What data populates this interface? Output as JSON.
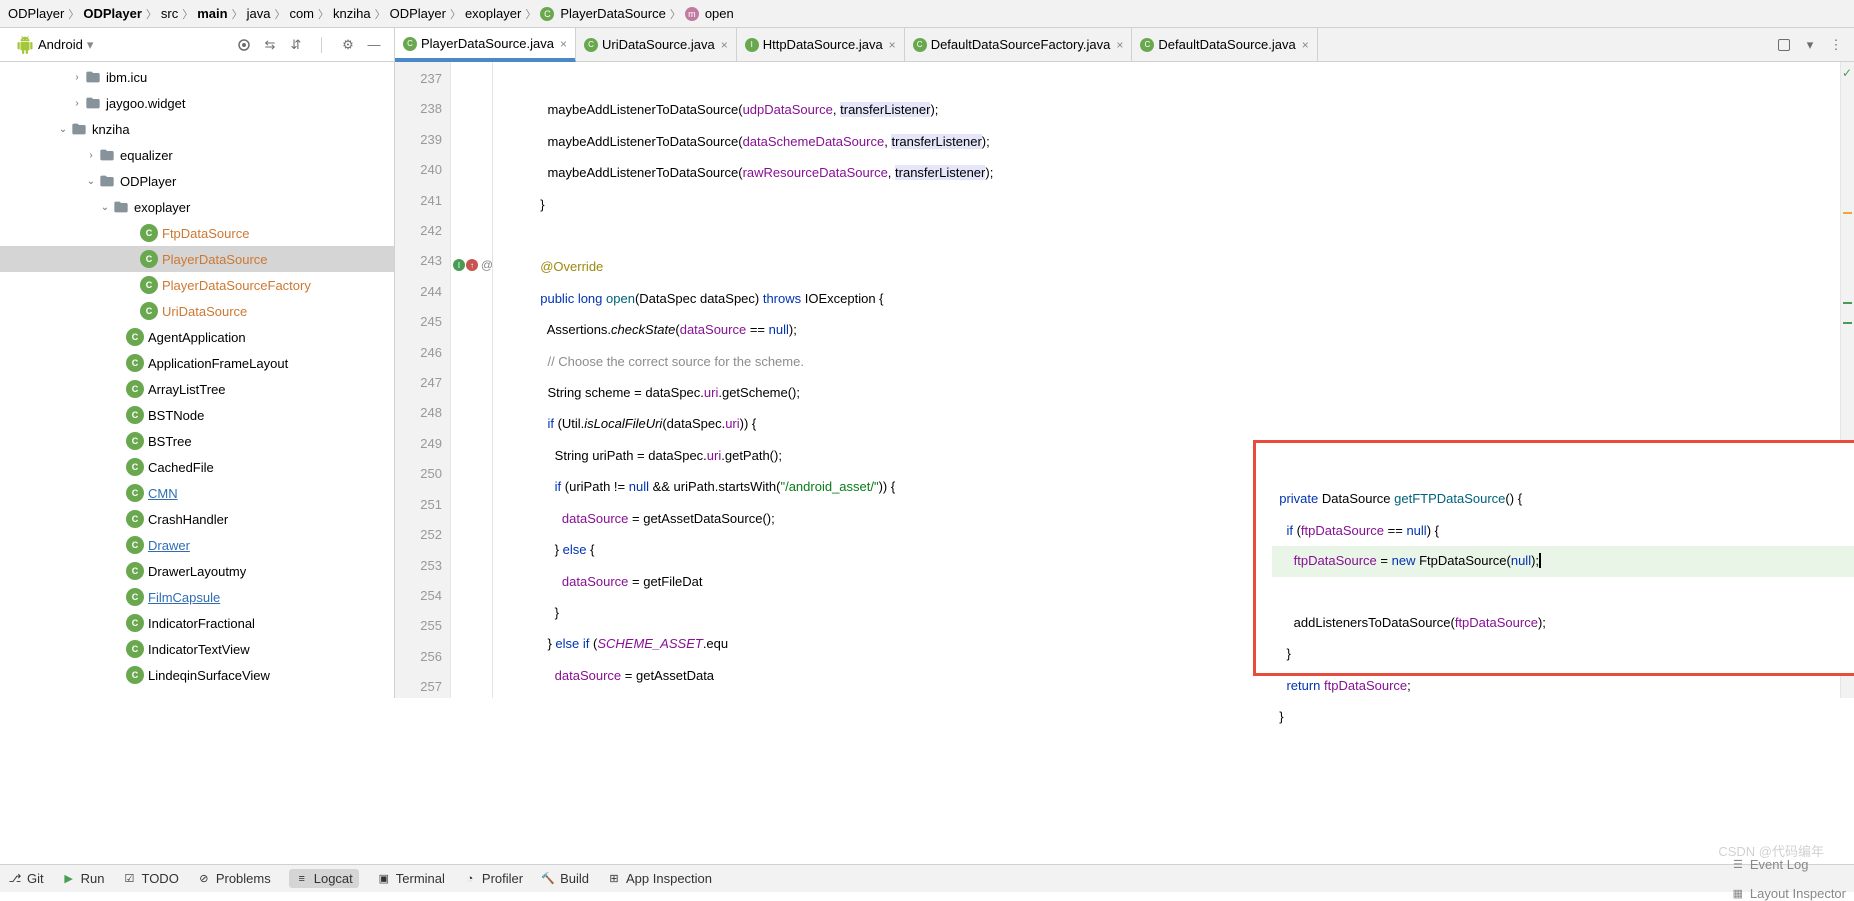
{
  "breadcrumb": {
    "items": [
      "ODPlayer",
      "ODPlayer",
      "src",
      "main",
      "java",
      "com",
      "knziha",
      "ODPlayer",
      "exoplayer",
      "PlayerDataSource",
      "open"
    ],
    "bold": [
      1,
      3
    ]
  },
  "sidebar": {
    "combo": "Android",
    "tree": [
      {
        "indent": 5,
        "tw": ">",
        "icon": "folder",
        "label": "ibm.icu"
      },
      {
        "indent": 5,
        "tw": ">",
        "icon": "folder",
        "label": "jaygoo.widget"
      },
      {
        "indent": 4,
        "tw": "v",
        "icon": "folder",
        "label": "knziha"
      },
      {
        "indent": 6,
        "tw": ">",
        "icon": "folder",
        "label": "equalizer"
      },
      {
        "indent": 6,
        "tw": "v",
        "icon": "folder",
        "label": "ODPlayer"
      },
      {
        "indent": 7,
        "tw": "v",
        "icon": "folder",
        "label": "exoplayer"
      },
      {
        "indent": 9,
        "tw": "",
        "icon": "class",
        "label": "FtpDataSource",
        "cls": "orange"
      },
      {
        "indent": 9,
        "tw": "",
        "icon": "class",
        "label": "PlayerDataSource",
        "cls": "orange",
        "sel": true
      },
      {
        "indent": 9,
        "tw": "",
        "icon": "class",
        "label": "PlayerDataSourceFactory",
        "cls": "orange"
      },
      {
        "indent": 9,
        "tw": "",
        "icon": "class",
        "label": "UriDataSource",
        "cls": "orange"
      },
      {
        "indent": 8,
        "tw": "",
        "icon": "class",
        "label": "AgentApplication"
      },
      {
        "indent": 8,
        "tw": "",
        "icon": "class",
        "label": "ApplicationFrameLayout"
      },
      {
        "indent": 8,
        "tw": "",
        "icon": "class",
        "label": "ArrayListTree"
      },
      {
        "indent": 8,
        "tw": "",
        "icon": "class",
        "label": "BSTNode"
      },
      {
        "indent": 8,
        "tw": "",
        "icon": "class",
        "label": "BSTree"
      },
      {
        "indent": 8,
        "tw": "",
        "icon": "class",
        "label": "CachedFile"
      },
      {
        "indent": 8,
        "tw": "",
        "icon": "class",
        "label": "CMN",
        "cls": "blue"
      },
      {
        "indent": 8,
        "tw": "",
        "icon": "class",
        "label": "CrashHandler"
      },
      {
        "indent": 8,
        "tw": "",
        "icon": "class",
        "label": "Drawer",
        "cls": "blue"
      },
      {
        "indent": 8,
        "tw": "",
        "icon": "class",
        "label": "DrawerLayoutmy"
      },
      {
        "indent": 8,
        "tw": "",
        "icon": "class",
        "label": "FilmCapsule",
        "cls": "blue"
      },
      {
        "indent": 8,
        "tw": "",
        "icon": "class",
        "label": "IndicatorFractional"
      },
      {
        "indent": 8,
        "tw": "",
        "icon": "class",
        "label": "IndicatorTextView"
      },
      {
        "indent": 8,
        "tw": "",
        "icon": "class",
        "label": "LindeqinSurfaceView"
      }
    ]
  },
  "tabs": [
    {
      "ico": "c",
      "label": "PlayerDataSource.java",
      "active": true
    },
    {
      "ico": "c",
      "label": "UriDataSource.java"
    },
    {
      "ico": "i",
      "label": "HttpDataSource.java"
    },
    {
      "ico": "c",
      "label": "DefaultDataSourceFactory.java"
    },
    {
      "ico": "c",
      "label": "DefaultDataSource.java"
    }
  ],
  "line_numbers": [
    "237",
    "238",
    "239",
    "240",
    "241",
    "242",
    "243",
    "244",
    "245",
    "246",
    "247",
    "248",
    "249",
    "250",
    "251",
    "252",
    "253",
    "254",
    "255",
    "256",
    "257"
  ],
  "bottom": {
    "git": "Git",
    "run": "Run",
    "todo": "TODO",
    "problems": "Problems",
    "logcat": "Logcat",
    "terminal": "Terminal",
    "profiler": "Profiler",
    "build": "Build",
    "appinsp": "App Inspection",
    "eventlog": "Event Log",
    "layoutinsp": "Layout Inspector"
  }
}
